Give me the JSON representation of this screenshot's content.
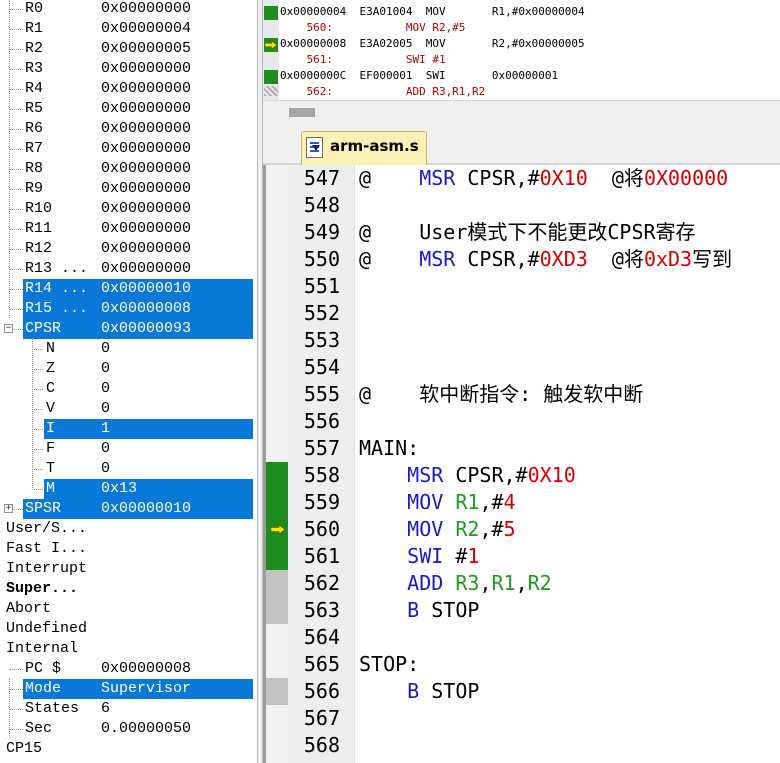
{
  "registers": {
    "top_rows": [
      {
        "name": "R0",
        "value": "0x00000000"
      },
      {
        "name": "R1",
        "value": "0x00000004"
      },
      {
        "name": "R2",
        "value": "0x00000005"
      },
      {
        "name": "R3",
        "value": "0x00000000"
      },
      {
        "name": "R4",
        "value": "0x00000000"
      },
      {
        "name": "R5",
        "value": "0x00000000"
      },
      {
        "name": "R6",
        "value": "0x00000000"
      },
      {
        "name": "R7",
        "value": "0x00000000"
      },
      {
        "name": "R8",
        "value": "0x00000000"
      },
      {
        "name": "R9",
        "value": "0x00000000"
      },
      {
        "name": "R10",
        "value": "0x00000000"
      },
      {
        "name": "R11",
        "value": "0x00000000"
      },
      {
        "name": "R12",
        "value": "0x00000000"
      },
      {
        "name": "R13 ...",
        "value": "0x00000000"
      },
      {
        "name": "R14 ...",
        "value": "0x00000010"
      },
      {
        "name": "R15 ...",
        "value": "0x00000008"
      }
    ],
    "cpsr": {
      "name": "CPSR",
      "value": "0x00000093",
      "expand": "−"
    },
    "cpsr_flags": [
      {
        "name": "N",
        "value": "0"
      },
      {
        "name": "Z",
        "value": "0"
      },
      {
        "name": "C",
        "value": "0"
      },
      {
        "name": "V",
        "value": "0"
      },
      {
        "name": "I",
        "value": "1"
      },
      {
        "name": "F",
        "value": "0"
      },
      {
        "name": "T",
        "value": "0"
      },
      {
        "name": "M",
        "value": "0x13"
      }
    ],
    "spsr": {
      "name": "SPSR",
      "value": "0x00000010",
      "expand": "+"
    },
    "modes": [
      "User/S...",
      "Fast I...",
      "Interrupt",
      "Super...",
      "Abort",
      "Undefined",
      "Internal"
    ],
    "internal": [
      {
        "name": "PC  $",
        "value": "0x00000008"
      },
      {
        "name": "Mode",
        "value": "Supervisor"
      },
      {
        "name": "States",
        "value": "6"
      },
      {
        "name": "Sec",
        "value": "0.00000050"
      }
    ],
    "cp15": "CP15"
  },
  "disassembly": [
    {
      "text": "0x00000004  E3A01004  MOV       R1,#0x00000004",
      "marker": "green",
      "source": false
    },
    {
      "text": "    560:           MOV R2,#5",
      "marker": "none",
      "source": true
    },
    {
      "text": "0x00000008  E3A02005  MOV       R2,#0x00000005",
      "marker": "arrow",
      "source": false
    },
    {
      "text": "    561:           SWI #1",
      "marker": "none",
      "source": true
    },
    {
      "text": "0x0000000C  EF000001  SWI       0x00000001",
      "marker": "green",
      "source": false
    },
    {
      "text": "    562:           ADD R3,R1,R2",
      "marker": "hatch",
      "source": true
    }
  ],
  "editor": {
    "tab_label": "arm-asm.s",
    "lines": [
      {
        "num": "547",
        "marker": "none",
        "parts": [
          {
            "t": "@    ",
            "c": "cmt"
          },
          {
            "t": "MSR",
            "c": "kw"
          },
          {
            "t": " CPSR,#",
            "c": "cmt"
          },
          {
            "t": "0X10",
            "c": "num-lit"
          },
          {
            "t": "  @将",
            "c": "cmt"
          },
          {
            "t": "0X00000",
            "c": "num-lit"
          }
        ]
      },
      {
        "num": "548",
        "marker": "none",
        "parts": []
      },
      {
        "num": "549",
        "marker": "none",
        "parts": [
          {
            "t": "@    User模式下不能更改CPSR寄存",
            "c": "cmt"
          }
        ]
      },
      {
        "num": "550",
        "marker": "none",
        "parts": [
          {
            "t": "@    ",
            "c": "cmt"
          },
          {
            "t": "MSR",
            "c": "kw"
          },
          {
            "t": " CPSR,#",
            "c": "cmt"
          },
          {
            "t": "0XD3",
            "c": "num-lit"
          },
          {
            "t": "  @将",
            "c": "cmt"
          },
          {
            "t": "0xD3",
            "c": "num-lit"
          },
          {
            "t": "写到",
            "c": "cmt"
          }
        ]
      },
      {
        "num": "551",
        "marker": "none",
        "parts": []
      },
      {
        "num": "552",
        "marker": "none",
        "parts": []
      },
      {
        "num": "553",
        "marker": "none",
        "parts": []
      },
      {
        "num": "554",
        "marker": "none",
        "parts": []
      },
      {
        "num": "555",
        "marker": "none",
        "parts": [
          {
            "t": "@    软中断指令: 触发软中断",
            "c": "cmt"
          }
        ]
      },
      {
        "num": "556",
        "marker": "none",
        "parts": []
      },
      {
        "num": "557",
        "marker": "none",
        "parts": [
          {
            "t": "MAIN:",
            "c": "cmt"
          }
        ]
      },
      {
        "num": "558",
        "marker": "green",
        "parts": [
          {
            "t": "    ",
            "c": "cmt"
          },
          {
            "t": "MSR",
            "c": "kw"
          },
          {
            "t": " CPSR,#",
            "c": "cmt"
          },
          {
            "t": "0X10",
            "c": "num-lit"
          }
        ]
      },
      {
        "num": "559",
        "marker": "green",
        "parts": [
          {
            "t": "    ",
            "c": "cmt"
          },
          {
            "t": "MOV",
            "c": "kw"
          },
          {
            "t": " ",
            "c": "cmt"
          },
          {
            "t": "R1",
            "c": "reg"
          },
          {
            "t": ",#",
            "c": "cmt"
          },
          {
            "t": "4",
            "c": "num-lit"
          }
        ]
      },
      {
        "num": "560",
        "marker": "arrow",
        "parts": [
          {
            "t": "    ",
            "c": "cmt"
          },
          {
            "t": "MOV",
            "c": "kw"
          },
          {
            "t": " ",
            "c": "cmt"
          },
          {
            "t": "R2",
            "c": "reg"
          },
          {
            "t": ",#",
            "c": "cmt"
          },
          {
            "t": "5",
            "c": "num-lit"
          }
        ]
      },
      {
        "num": "561",
        "marker": "green",
        "parts": [
          {
            "t": "    ",
            "c": "cmt"
          },
          {
            "t": "SWI",
            "c": "kw"
          },
          {
            "t": " #",
            "c": "cmt"
          },
          {
            "t": "1",
            "c": "num-lit"
          }
        ]
      },
      {
        "num": "562",
        "marker": "gray",
        "parts": [
          {
            "t": "    ",
            "c": "cmt"
          },
          {
            "t": "ADD",
            "c": "kw"
          },
          {
            "t": " ",
            "c": "cmt"
          },
          {
            "t": "R3",
            "c": "reg"
          },
          {
            "t": ",",
            "c": "cmt"
          },
          {
            "t": "R1",
            "c": "reg"
          },
          {
            "t": ",",
            "c": "cmt"
          },
          {
            "t": "R2",
            "c": "reg"
          }
        ]
      },
      {
        "num": "563",
        "marker": "gray",
        "parts": [
          {
            "t": "    ",
            "c": "cmt"
          },
          {
            "t": "B",
            "c": "kw"
          },
          {
            "t": " STOP",
            "c": "cmt"
          }
        ]
      },
      {
        "num": "564",
        "marker": "none",
        "parts": []
      },
      {
        "num": "565",
        "marker": "none",
        "parts": [
          {
            "t": "STOP:",
            "c": "cmt"
          }
        ]
      },
      {
        "num": "566",
        "marker": "gray",
        "parts": [
          {
            "t": "    ",
            "c": "cmt"
          },
          {
            "t": "B",
            "c": "kw"
          },
          {
            "t": " STOP",
            "c": "cmt"
          }
        ]
      },
      {
        "num": "567",
        "marker": "none",
        "parts": []
      },
      {
        "num": "568",
        "marker": "none",
        "parts": []
      }
    ]
  },
  "colors": {
    "selection": "#0a78d7",
    "exec_green": "#1e8c1e",
    "not_exec_gray": "#c2c2c2",
    "arrow_yellow": "#f5e600",
    "keyword": "#1a19c6",
    "register": "#1f9c1f",
    "number": "#d60000"
  }
}
